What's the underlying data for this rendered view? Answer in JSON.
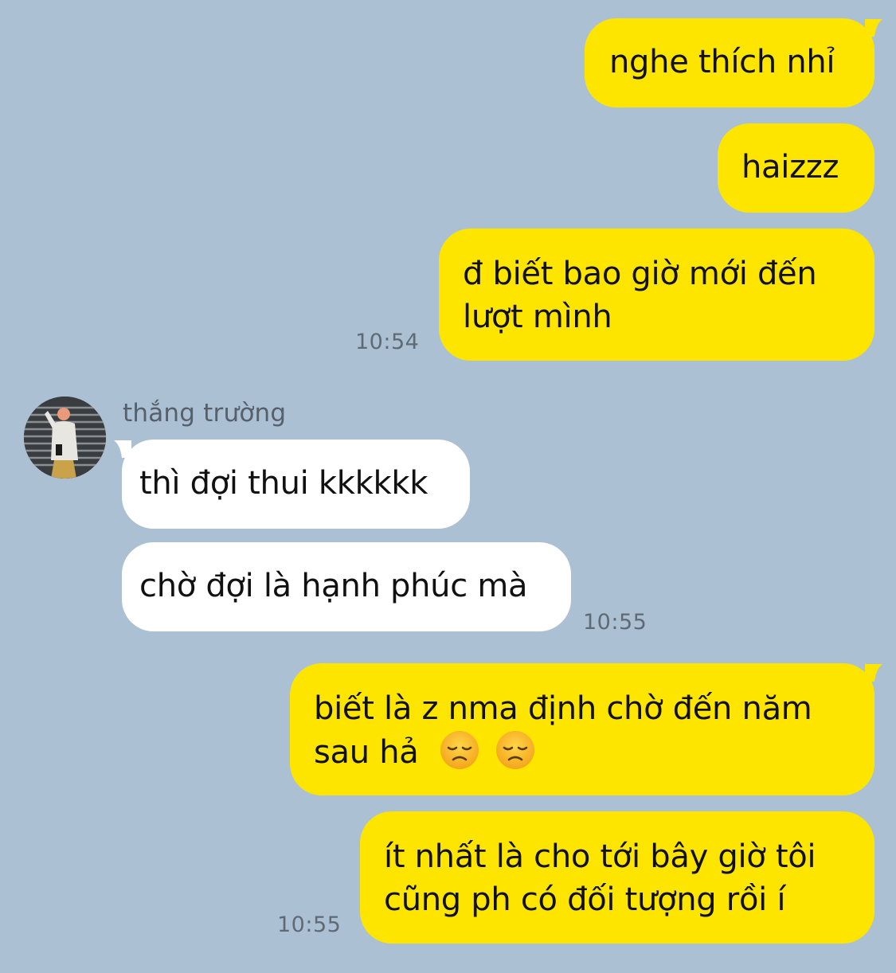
{
  "conversation": {
    "messages": [
      {
        "direction": "outgoing",
        "text": "nghe thích nhỉ"
      },
      {
        "direction": "outgoing",
        "text": "haizzz"
      },
      {
        "direction": "outgoing",
        "lines": [
          "đ biết bao giờ mới đến",
          "lượt mình"
        ],
        "time": "10:54"
      },
      {
        "direction": "incoming",
        "sender": "thắng trường",
        "text": "thì đợi thui kkkkkk"
      },
      {
        "direction": "incoming",
        "text": "chờ đợi là hạnh phúc mà",
        "time": "10:55"
      },
      {
        "direction": "outgoing",
        "lines": [
          "biết là z nma định chờ đến năm",
          "sau hả"
        ],
        "emojis": [
          "disappointed-face",
          "disappointed-face"
        ]
      },
      {
        "direction": "outgoing",
        "lines": [
          "ít nhất là cho tới bây giờ tôi",
          "cũng ph có đối tượng rồi í"
        ],
        "time": "10:55"
      }
    ]
  },
  "colors": {
    "background": "#abc0d3",
    "outgoing_bubble": "#fee500",
    "incoming_bubble": "#ffffff",
    "timestamp": "#5f6a75",
    "sender_name": "#56606b"
  }
}
